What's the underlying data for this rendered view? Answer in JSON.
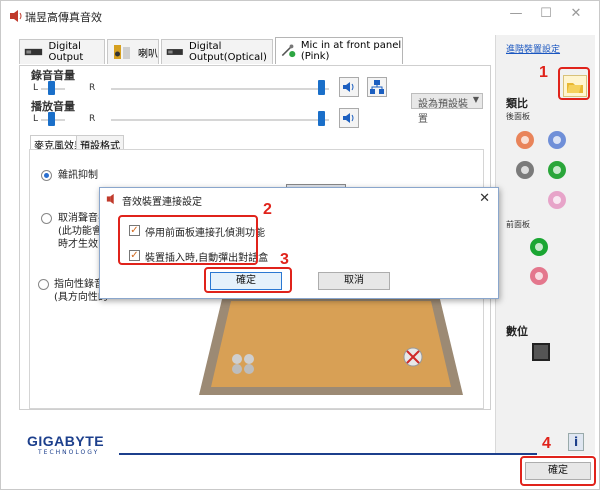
{
  "window": {
    "title": "瑞昱高傳真音效",
    "controls": [
      "—",
      "☐",
      "✕"
    ]
  },
  "tabs": [
    {
      "label": "Digital Output",
      "icon": "digital-output-icon"
    },
    {
      "label": "喇叭",
      "icon": "speaker-icon"
    },
    {
      "label": "Digital Output(Optical)",
      "icon": "optical-output-icon"
    },
    {
      "label": "Mic in at front panel (Pink)",
      "icon": "microphone-icon",
      "active": true
    }
  ],
  "volume": {
    "record_label": "錄音音量",
    "playback_label": "播放音量",
    "left": "L",
    "right": "R",
    "record_level": 1.0,
    "playback_level": 1.0,
    "default_device_label": "設為預設裝置"
  },
  "subtabs": [
    "麥克風效果",
    "預設格式"
  ],
  "effects": [
    {
      "lines": [
        "雜訊抑制"
      ],
      "selected": true
    },
    {
      "lines": [
        "取消聲音共",
        "(此功能會",
        "時才生效)"
      ],
      "selected": false
    },
    {
      "lines": [
        "指向性錄音",
        "(具方向性的"
      ],
      "selected": false
    }
  ],
  "right_panel": {
    "advanced_link": "進階裝置設定",
    "analog_label": "類比",
    "back_panel_label": "後面板",
    "front_panel_label": "前面板",
    "digital_label": "數位",
    "jack_colors": {
      "back": [
        "#e9845a",
        "#6f8fd8",
        "#7b7b7b",
        "#2aa63a",
        "#e7a4c9"
      ],
      "front": [
        "#1aa632",
        "#e4778d"
      ]
    }
  },
  "dialog": {
    "title": "音效裝置連接設定",
    "checkbox1": "停用前面板連接孔偵測功能",
    "checkbox2": "裝置插入時,自動彈出對話盒",
    "checkbox1_checked": true,
    "checkbox2_checked": true,
    "ok": "確定",
    "cancel": "取消"
  },
  "footer": {
    "brand": "GIGABYTE",
    "brand_sub": "TECHNOLOGY",
    "ok": "確定"
  },
  "annotations": [
    "1",
    "2",
    "3",
    "4"
  ],
  "accent_color": "#e0231b"
}
